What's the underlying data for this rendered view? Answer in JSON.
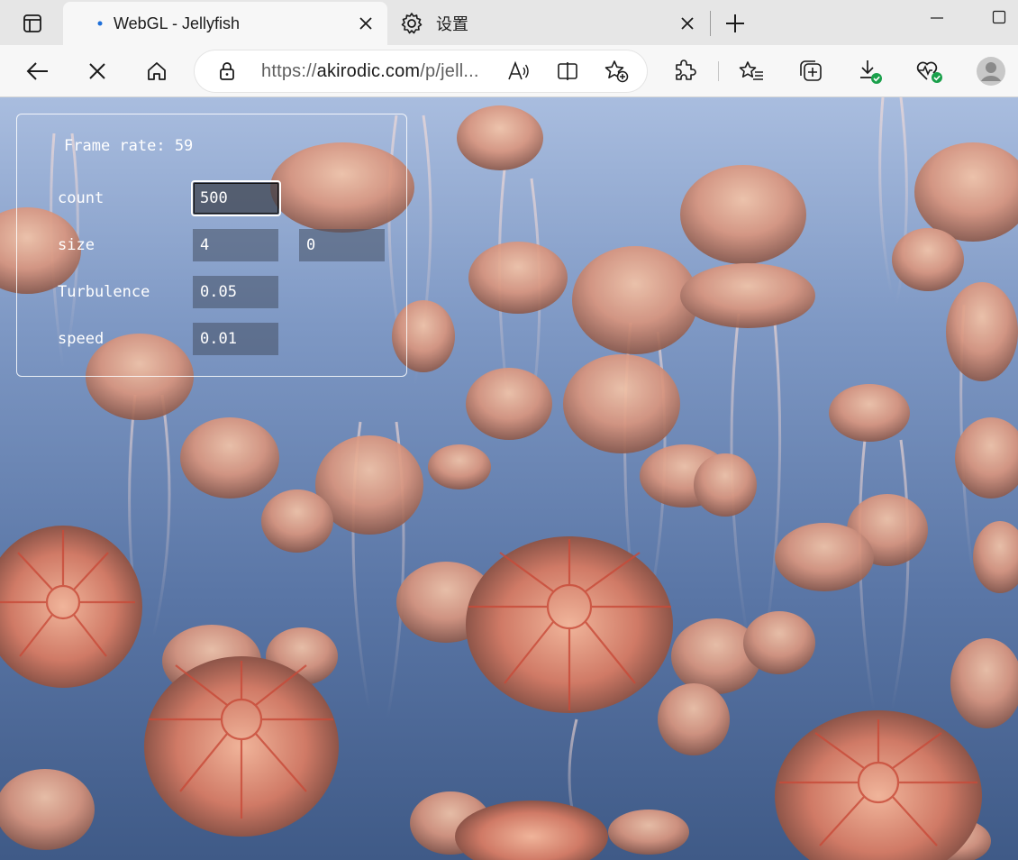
{
  "tabs": [
    {
      "title": "WebGL - Jellyfish",
      "active": true
    },
    {
      "title": "设置",
      "active": false
    }
  ],
  "icons": {
    "tab_actions": "tab-actions-icon",
    "favicon": "dot-favicon-icon",
    "settings": "gear-icon",
    "close": "close-icon",
    "new_tab": "plus-icon",
    "minimize": "minimize-icon",
    "maximize": "maximize-icon",
    "back": "back-arrow-icon",
    "stop": "stop-x-icon",
    "home": "home-icon",
    "lock": "lock-icon",
    "read_aloud": "read-aloud-icon",
    "split_screen": "split-screen-icon",
    "add_favorite": "star-add-icon",
    "extensions": "puzzle-icon",
    "favorites": "favorites-list-icon",
    "collections": "collections-icon",
    "downloads": "download-icon",
    "browser_essentials": "heart-pulse-icon",
    "profile": "avatar-icon"
  },
  "address_bar": {
    "url_prefix": "https://",
    "url_host": "akirodic.com",
    "url_rest": "/p/jell..."
  },
  "panel": {
    "frame_rate_label": "Frame rate: 59",
    "controls": {
      "count": {
        "label": "count",
        "value": "500"
      },
      "size": {
        "label": "size",
        "value1": "4",
        "value2": "0"
      },
      "turbulence": {
        "label": "Turbulence",
        "value": "0.05"
      },
      "speed": {
        "label": "speed",
        "value": "0.01"
      }
    }
  },
  "colors": {
    "tab_strip": "#e6e6e6",
    "toolbar": "#f7f7f7",
    "favicon_dot": "#1e6fd9",
    "status_green": "#1aa04b",
    "ocean_top": "#a9bddf",
    "ocean_bottom": "#3f5a87",
    "jellyfish": "#d9957e"
  }
}
